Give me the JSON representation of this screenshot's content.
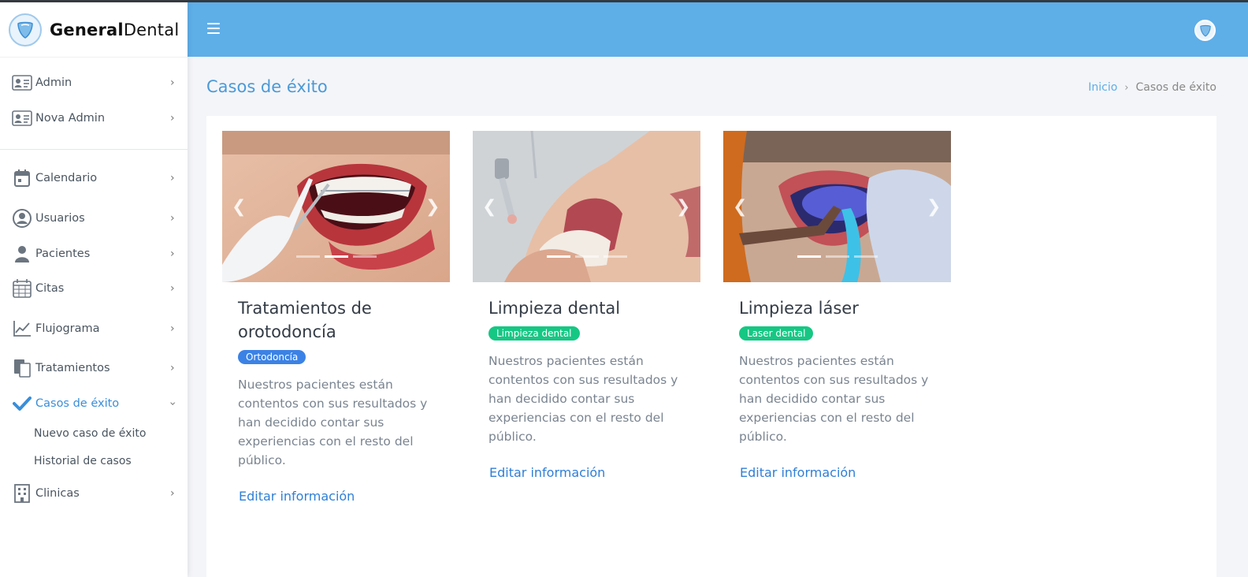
{
  "brand": {
    "name_bold": "General",
    "name_light": "Dental"
  },
  "sidebar": {
    "top_items": [
      {
        "label": "Admin"
      },
      {
        "label": "Nova Admin"
      }
    ],
    "items": [
      {
        "label": "Calendario"
      },
      {
        "label": "Usuarios"
      },
      {
        "label": "Pacientes"
      },
      {
        "label": "Citas"
      },
      {
        "label": "Flujograma"
      },
      {
        "label": "Tratamientos"
      },
      {
        "label": "Casos de éxito",
        "active": true
      },
      {
        "label": "Clinicas"
      }
    ],
    "submenu": [
      {
        "label": "Nuevo caso de éxito"
      },
      {
        "label": "Historial de casos"
      }
    ]
  },
  "page": {
    "title": "Casos de éxito",
    "breadcrumb": {
      "home": "Inicio",
      "current": "Casos de éxito"
    }
  },
  "cards": [
    {
      "title": "Tratamientos de orotodoncía",
      "badge": "Ortodoncía",
      "text": "Nuestros pacientes están contentos con sus resultados y han decidido contar sus experiencias con el resto del público.",
      "link": "Editar información",
      "active_slide": 1
    },
    {
      "title": "Limpieza dental",
      "badge": "Limpieza dental",
      "text": "Nuestros pacientes están contentos con sus resultados y han decidido contar sus experiencias con el resto del público.",
      "link": "Editar información",
      "active_slide": 0
    },
    {
      "title": "Limpieza láser",
      "badge": "Laser dental",
      "text": "Nuestros pacientes están contentos con sus resultados y han decidido contar sus experiencias con el resto del público.",
      "link": "Editar información",
      "active_slide": 0
    }
  ],
  "icons": {
    "hamburger": "menu-icon",
    "avatar": "user-avatar-icon",
    "carousel_prev": "chevron-left-icon",
    "carousel_next": "chevron-right-icon"
  },
  "colors": {
    "header": "#5eaee8",
    "accent": "#3a8ed8",
    "badge_blue": "#3b82e6",
    "badge_green": "#16c784"
  }
}
